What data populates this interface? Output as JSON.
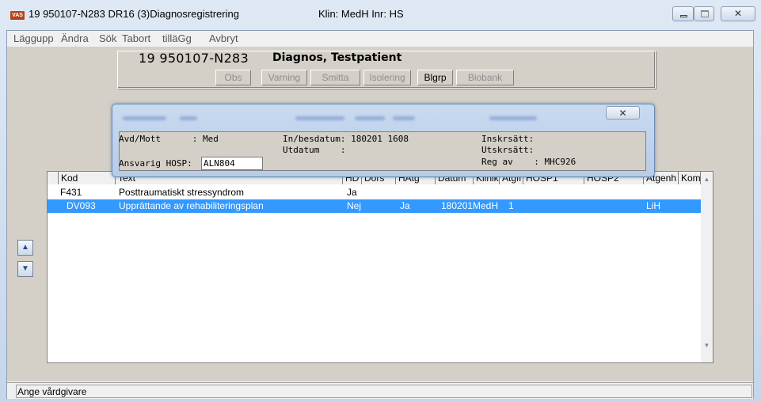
{
  "window": {
    "app_badge": "VAS",
    "title": "19 950107-N283   DR16 (3)Diagnosregistrering",
    "klin": "Klin: MedH  Inr: HS",
    "close_glyph": "✕"
  },
  "menu": [
    "Läggupp",
    "Ändra",
    "Sök",
    "Tabort",
    "tilläGg",
    "Avbryt"
  ],
  "patient": {
    "id": "19 950107-N283",
    "name": "Diagnos, Testpatient"
  },
  "flags": [
    {
      "label": "Obs",
      "active": false
    },
    {
      "label": "Varning",
      "active": false
    },
    {
      "label": "Smitta",
      "active": false
    },
    {
      "label": "Isolering",
      "active": false
    },
    {
      "label": "Blgrp",
      "active": true
    },
    {
      "label": "Biobank",
      "active": false
    }
  ],
  "popup": {
    "close_glyph": "✕",
    "avd_label": "Avd/Mott      : Med",
    "in_label": "In/besdatum: 180201 1608",
    "ut_label": "Utdatum    :",
    "inskr_label": "Inskrsätt:",
    "utskr_label": "Utskrsätt:",
    "regav_label": "Reg av    : MHC926",
    "hosp_label": "Ansvarig HOSP:",
    "hosp_value": "ALN804"
  },
  "grid": {
    "headers": [
      "Kod",
      "Text",
      "HD",
      "Dors",
      "HAtg",
      "Datum",
      "Klinik",
      "Atgfi",
      "HOSP1",
      "HOSP2",
      "Atgenh",
      "Kompl"
    ],
    "rows": [
      {
        "kod": "F431",
        "text": "Posttraumatiskt stressyndrom",
        "hd": "Ja",
        "hatg": "",
        "datum": "",
        "klinik": "",
        "atgfi": "",
        "atgenh": "",
        "selected": false
      },
      {
        "kod": "DV093",
        "text": "Upprättande av rehabiliteringsplan",
        "hd": "Nej",
        "hatg": "Ja",
        "datum": "180201",
        "klinik": "MedH",
        "atgfi": "1",
        "atgenh": "LiH",
        "selected": true
      }
    ]
  },
  "nav": {
    "up_glyph": "▲",
    "down_glyph": "▼"
  },
  "status": {
    "text": "Ange vårdgivare"
  }
}
